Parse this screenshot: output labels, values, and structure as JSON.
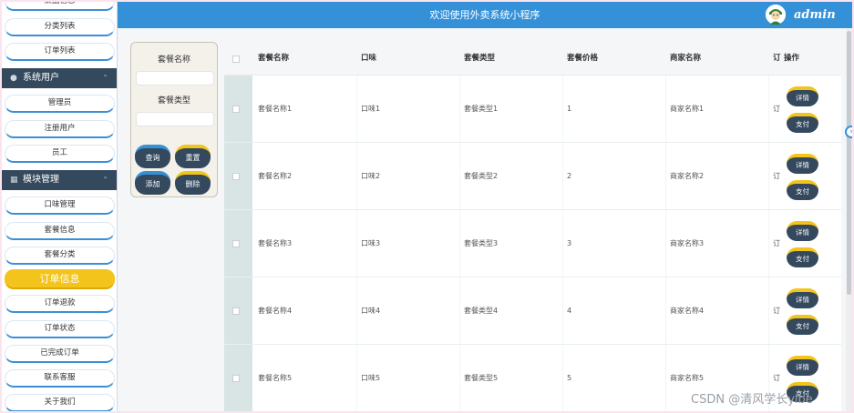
{
  "app": {
    "title": "欢迎使用外卖系统小程序",
    "user": "admin",
    "watermark": "CSDN @清风学长ylbe"
  },
  "sidebar": {
    "top_partial": "菜品信息",
    "items_a": [
      "分类列表",
      "订单列表"
    ],
    "group1": {
      "label": "系统用户",
      "icon": "user-icon"
    },
    "items_b": [
      "管理员",
      "注册用户",
      "员工"
    ],
    "group2": {
      "label": "模块管理",
      "icon": "grid-icon"
    },
    "items_c": [
      "口味管理",
      "套餐信息",
      "套餐分类"
    ],
    "active": "订单信息",
    "items_d": [
      "订单退款",
      "订单状态",
      "已完成订单",
      "联系客服",
      "关于我们"
    ]
  },
  "search": {
    "label1": "套餐名称",
    "label2": "套餐类型",
    "query_btn": "查询",
    "reset_btn": "重置",
    "add_btn": "添加",
    "delete_btn": "删除"
  },
  "table": {
    "headers": [
      "套餐名称",
      "口味",
      "套餐类型",
      "套餐价格",
      "商家名称",
      "订",
      "操作"
    ],
    "rows": [
      [
        "套餐名称1",
        "口味1",
        "套餐类型1",
        "1",
        "商家名称1",
        "订"
      ],
      [
        "套餐名称2",
        "口味2",
        "套餐类型2",
        "2",
        "商家名称2",
        "订"
      ],
      [
        "套餐名称3",
        "口味3",
        "套餐类型3",
        "3",
        "商家名称3",
        "订"
      ],
      [
        "套餐名称4",
        "口味4",
        "套餐类型4",
        "4",
        "商家名称4",
        "订"
      ],
      [
        "套餐名称5",
        "口味5",
        "套餐类型5",
        "5",
        "商家名称5",
        "订"
      ]
    ],
    "detail_btn": "详情",
    "pay_btn": "支付"
  },
  "colors": {
    "topbar": "#3591d7",
    "sidebar_header": "#34495e",
    "active": "#f3c41b"
  }
}
